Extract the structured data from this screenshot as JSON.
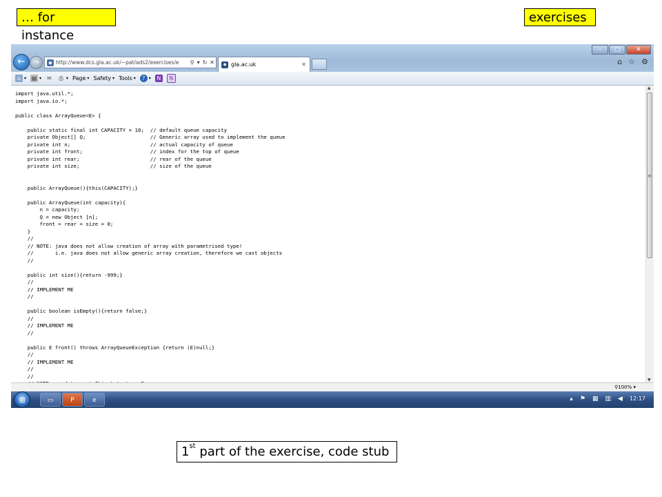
{
  "slide": {
    "label_left": "… for instance",
    "label_right": "exercises",
    "caption_sup": "st",
    "caption_num": "1",
    "caption_text": " part of the exercise, code stub"
  },
  "browser": {
    "url": "http://www.dcs.gla.ac.uk/~pat/ads2/exercises/e",
    "tab_title": "gla.ac.uk",
    "command_bar": [
      "Page",
      "Safety",
      "Tools"
    ],
    "zoom": "100%"
  },
  "code_lines": [
    "import java.util.*;",
    "import java.io.*;",
    "",
    "public class ArrayQueue<E> {",
    "",
    "    public static final int CAPACITY = 10;  // default queue capacity",
    "    private Object[] Q;                     // Generic array used to implement the queue",
    "    private int n;                          // actual capacity of queue",
    "    private int front;                      // index for the top of queue",
    "    private int rear;                       // rear of the queue",
    "    private int size;                       // size of the queue",
    "",
    "",
    "    public ArrayQueue(){this(CAPACITY);}",
    "",
    "    public ArrayQueue(int capacity){",
    "        n = capacity;",
    "        Q = new Object [n];",
    "        front = rear = size = 0;",
    "    }",
    "    //",
    "    // NOTE: java does not allow creation of array with parametrised type!",
    "    //       i.e. java does not allow generic array creation, therefore we cast objects",
    "    //",
    "",
    "    public int size(){return -999;}",
    "    //",
    "    // IMPLEMENT ME",
    "    //",
    "",
    "    public boolean isEmpty(){return false;}",
    "    //",
    "    // IMPLEMENT ME",
    "    //",
    "",
    "    public E front() throws ArrayQueueException {return (E)null;}",
    "    //",
    "    // IMPLEMENT ME",
    "    //",
    "    //",
    "    // NOTE: need to cast Object to type E"
  ],
  "taskbar": {
    "clock": "12:17"
  },
  "icons": [
    "back-arrow-icon",
    "forward-arrow-icon",
    "refresh-icon",
    "stop-icon",
    "home-icon",
    "star-icon",
    "gear-icon",
    "windows-start-icon"
  ]
}
